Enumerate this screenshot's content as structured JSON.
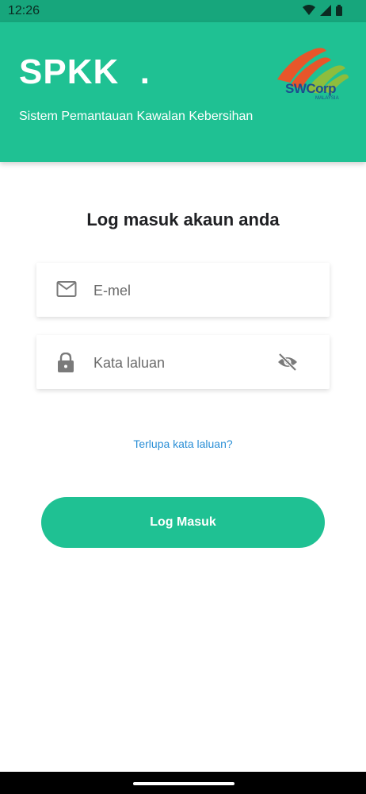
{
  "status_bar": {
    "time": "12:26",
    "icons": [
      "wifi-icon",
      "signal-icon",
      "battery-icon"
    ]
  },
  "header": {
    "title": "SPKK  .",
    "subtitle": "Sistem Pemantauan Kawalan Kebersihan",
    "logo": {
      "text": "SWCorp",
      "subtext": "MALAYSIA"
    }
  },
  "login": {
    "title": "Log masuk akaun anda",
    "email": {
      "placeholder": "E-mel",
      "value": "",
      "icon": "mail-icon"
    },
    "password": {
      "placeholder": "Kata laluan",
      "value": "",
      "icon": "lock-icon",
      "toggle_icon": "visibility-off-icon"
    },
    "forgot_label": "Terlupa kata laluan?",
    "submit_label": "Log Masuk"
  },
  "colors": {
    "status_bar": "#17a67c",
    "header": "#1fc193",
    "button": "#1fc193",
    "link": "#2b8fd6",
    "logo_orange": "#e8562a",
    "logo_green": "#8dbd3d",
    "logo_blue": "#1d4e8f"
  }
}
